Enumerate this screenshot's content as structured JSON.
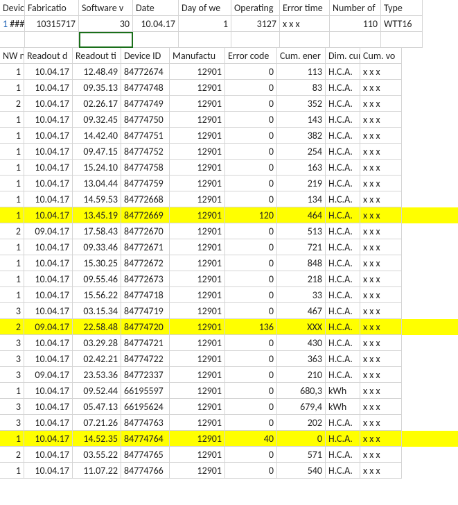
{
  "header1": {
    "cols": [
      "Devic",
      "Fabricatio",
      "Software v",
      "Date",
      "Day of we",
      "Operating",
      "Error time",
      "Number of",
      "Type"
    ]
  },
  "header1_data": {
    "cells": [
      "###",
      "10315717",
      "30",
      "10.04.17",
      "1",
      "3127",
      "x x x",
      "110",
      "WTT16"
    ]
  },
  "header2": {
    "cols": [
      "NW n",
      "Readout d",
      "Readout ti",
      "Device ID",
      "Manufactu",
      "Error code",
      "Cum. ener",
      "Dim. cum.",
      "Cum. vo"
    ]
  },
  "rows": [
    {
      "hl": false,
      "n": "1",
      "rd": "10.04.17",
      "rt": "12.48.49",
      "id": "84772674",
      "mf": "12901",
      "ec": "0",
      "ce": "113",
      "dim": "H.C.A.",
      "cv": "x x x"
    },
    {
      "hl": false,
      "n": "1",
      "rd": "10.04.17",
      "rt": "09.35.13",
      "id": "84774748",
      "mf": "12901",
      "ec": "0",
      "ce": "83",
      "dim": "H.C.A.",
      "cv": "x x x"
    },
    {
      "hl": false,
      "n": "2",
      "rd": "10.04.17",
      "rt": "02.26.17",
      "id": "84774749",
      "mf": "12901",
      "ec": "0",
      "ce": "352",
      "dim": "H.C.A.",
      "cv": "x x x"
    },
    {
      "hl": false,
      "n": "1",
      "rd": "10.04.17",
      "rt": "09.32.45",
      "id": "84774750",
      "mf": "12901",
      "ec": "0",
      "ce": "143",
      "dim": "H.C.A.",
      "cv": "x x x"
    },
    {
      "hl": false,
      "n": "1",
      "rd": "10.04.17",
      "rt": "14.42.40",
      "id": "84774751",
      "mf": "12901",
      "ec": "0",
      "ce": "382",
      "dim": "H.C.A.",
      "cv": "x x x"
    },
    {
      "hl": false,
      "n": "1",
      "rd": "10.04.17",
      "rt": "09.47.15",
      "id": "84774752",
      "mf": "12901",
      "ec": "0",
      "ce": "254",
      "dim": "H.C.A.",
      "cv": "x x x"
    },
    {
      "hl": false,
      "n": "1",
      "rd": "10.04.17",
      "rt": "15.24.10",
      "id": "84774758",
      "mf": "12901",
      "ec": "0",
      "ce": "163",
      "dim": "H.C.A.",
      "cv": "x x x"
    },
    {
      "hl": false,
      "n": "1",
      "rd": "10.04.17",
      "rt": "13.04.44",
      "id": "84774759",
      "mf": "12901",
      "ec": "0",
      "ce": "219",
      "dim": "H.C.A.",
      "cv": "x x x"
    },
    {
      "hl": false,
      "n": "1",
      "rd": "10.04.17",
      "rt": "14.59.53",
      "id": "84772668",
      "mf": "12901",
      "ec": "0",
      "ce": "134",
      "dim": "H.C.A.",
      "cv": "x x x"
    },
    {
      "hl": true,
      "n": "1",
      "rd": "10.04.17",
      "rt": "13.45.19",
      "id": "84772669",
      "mf": "12901",
      "ec": "120",
      "ce": "464",
      "dim": "H.C.A.",
      "cv": "x x x"
    },
    {
      "hl": false,
      "n": "2",
      "rd": "09.04.17",
      "rt": "17.58.43",
      "id": "84772670",
      "mf": "12901",
      "ec": "0",
      "ce": "513",
      "dim": "H.C.A.",
      "cv": "x x x"
    },
    {
      "hl": false,
      "n": "1",
      "rd": "10.04.17",
      "rt": "09.33.46",
      "id": "84772671",
      "mf": "12901",
      "ec": "0",
      "ce": "721",
      "dim": "H.C.A.",
      "cv": "x x x"
    },
    {
      "hl": false,
      "n": "1",
      "rd": "10.04.17",
      "rt": "15.30.25",
      "id": "84772672",
      "mf": "12901",
      "ec": "0",
      "ce": "848",
      "dim": "H.C.A.",
      "cv": "x x x"
    },
    {
      "hl": false,
      "n": "1",
      "rd": "10.04.17",
      "rt": "09.55.46",
      "id": "84772673",
      "mf": "12901",
      "ec": "0",
      "ce": "218",
      "dim": "H.C.A.",
      "cv": "x x x"
    },
    {
      "hl": false,
      "n": "1",
      "rd": "10.04.17",
      "rt": "15.56.22",
      "id": "84774718",
      "mf": "12901",
      "ec": "0",
      "ce": "33",
      "dim": "H.C.A.",
      "cv": "x x x"
    },
    {
      "hl": false,
      "n": "3",
      "rd": "10.04.17",
      "rt": "03.15.34",
      "id": "84774719",
      "mf": "12901",
      "ec": "0",
      "ce": "467",
      "dim": "H.C.A.",
      "cv": "x x x"
    },
    {
      "hl": true,
      "n": "2",
      "rd": "09.04.17",
      "rt": "22.58.48",
      "id": "84774720",
      "mf": "12901",
      "ec": "136",
      "ce": "XXX",
      "dim": "H.C.A.",
      "cv": "x x x"
    },
    {
      "hl": false,
      "n": "3",
      "rd": "10.04.17",
      "rt": "03.29.28",
      "id": "84774721",
      "mf": "12901",
      "ec": "0",
      "ce": "430",
      "dim": "H.C.A.",
      "cv": "x x x"
    },
    {
      "hl": false,
      "n": "3",
      "rd": "10.04.17",
      "rt": "02.42.21",
      "id": "84774722",
      "mf": "12901",
      "ec": "0",
      "ce": "363",
      "dim": "H.C.A.",
      "cv": "x x x"
    },
    {
      "hl": false,
      "n": "3",
      "rd": "09.04.17",
      "rt": "23.53.36",
      "id": "84772337",
      "mf": "12901",
      "ec": "0",
      "ce": "210",
      "dim": "H.C.A.",
      "cv": "x x x"
    },
    {
      "hl": false,
      "n": "1",
      "rd": "10.04.17",
      "rt": "09.52.44",
      "id": "66195597",
      "mf": "12901",
      "ec": "0",
      "ce": "680,3",
      "dim": "kWh",
      "cv": "x x x"
    },
    {
      "hl": false,
      "n": "3",
      "rd": "10.04.17",
      "rt": "05.47.13",
      "id": "66195624",
      "mf": "12901",
      "ec": "0",
      "ce": "679,4",
      "dim": "kWh",
      "cv": "x x x"
    },
    {
      "hl": false,
      "n": "3",
      "rd": "10.04.17",
      "rt": "07.21.26",
      "id": "84774763",
      "mf": "12901",
      "ec": "0",
      "ce": "202",
      "dim": "H.C.A.",
      "cv": "x x x"
    },
    {
      "hl": true,
      "n": "1",
      "rd": "10.04.17",
      "rt": "14.52.35",
      "id": "84774764",
      "mf": "12901",
      "ec": "40",
      "ce": "0",
      "dim": "H.C.A.",
      "cv": "x x x"
    },
    {
      "hl": false,
      "n": "2",
      "rd": "10.04.17",
      "rt": "03.55.22",
      "id": "84774765",
      "mf": "12901",
      "ec": "0",
      "ce": "571",
      "dim": "H.C.A.",
      "cv": "x x x"
    },
    {
      "hl": false,
      "n": "1",
      "rd": "10.04.17",
      "rt": "11.07.22",
      "id": "84774766",
      "mf": "12901",
      "ec": "0",
      "ce": "540",
      "dim": "H.C.A.",
      "cv": "x x x"
    }
  ],
  "misc": {
    "hdr1_lead": "1"
  }
}
